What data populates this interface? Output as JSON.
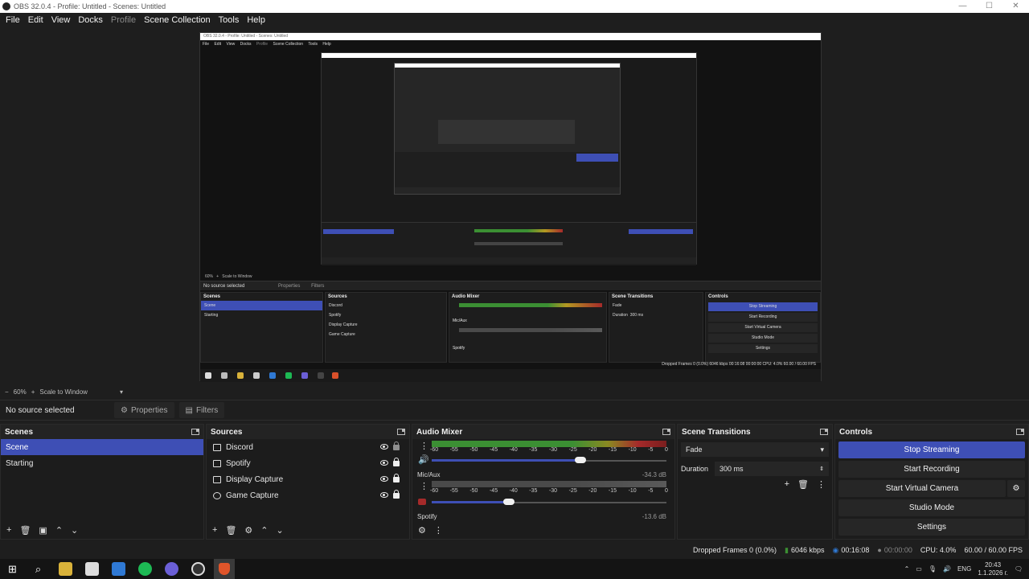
{
  "window": {
    "title": "OBS 32.0.4 - Profile: Untitled - Scenes: Untitled",
    "buttons": [
      "—",
      "☐",
      "✕"
    ]
  },
  "menu": [
    "File",
    "Edit",
    "View",
    "Docks",
    "Profile",
    "Scene Collection",
    "Tools",
    "Help"
  ],
  "nested": {
    "title": "OBS 32.0.4 - Profile: Untitled - Scenes: Untitled",
    "menu": [
      "File",
      "Edit",
      "View",
      "Docks",
      "Profile",
      "Scene Collection",
      "Tools",
      "Help"
    ],
    "status_zoom": "60%",
    "scale": "Scale to Window",
    "no_source": "No source selected",
    "properties": "Properties",
    "filters": "Filters",
    "scenes_head": "Scenes",
    "scenes": [
      "Scene",
      "Starting"
    ],
    "sources_head": "Sources",
    "sources": [
      "Discord",
      "Spotify",
      "Display Capture",
      "Game Capture"
    ],
    "mixer_head": "Audio Mixer",
    "mic": "Mic/Aux",
    "spotify": "Spotify",
    "transitions_head": "Scene Transitions",
    "fade": "Fade",
    "duration": "Duration",
    "duration_val": "300 ms",
    "controls_head": "Controls",
    "controls": [
      "Stop Streaming",
      "Start Recording",
      "Start Virtual Camera",
      "Studio Mode",
      "Settings"
    ],
    "statusbar": "Dropped Frames 0 (0.0%)   6046 kbps   00:16:08   00:00:00   CPU: 4.0%   60.00 / 60.00 FPS"
  },
  "zoom_row": {
    "zoom": "60%",
    "scale": "Scale to Window"
  },
  "props_bar": {
    "no_source": "No source selected",
    "properties": "Properties",
    "filters": "Filters"
  },
  "scenes": {
    "title": "Scenes",
    "items": [
      "Scene",
      "Starting"
    ],
    "selected": 0
  },
  "sources": {
    "title": "Sources",
    "items": [
      "Discord",
      "Spotify",
      "Display Capture",
      "Game Capture"
    ]
  },
  "mixer": {
    "title": "Audio Mixer",
    "ticks": [
      "-60",
      "-55",
      "-50",
      "-45",
      "-40",
      "-35",
      "-30",
      "-25",
      "-20",
      "-15",
      "-10",
      "-5",
      "0"
    ],
    "channels": [
      {
        "name": "",
        "db": "",
        "level": 0.62
      },
      {
        "name": "Mic/Aux",
        "db": "-34.3 dB",
        "level": 0.36
      },
      {
        "name": "Spotify",
        "db": "-13.6 dB",
        "level": 0.0
      }
    ]
  },
  "transitions": {
    "title": "Scene Transitions",
    "selected": "Fade",
    "duration_label": "Duration",
    "duration_value": "300 ms"
  },
  "controls": {
    "title": "Controls",
    "buttons": [
      "Stop Streaming",
      "Start Recording",
      "Start Virtual Camera",
      "Studio Mode",
      "Settings"
    ]
  },
  "status": {
    "dropped": "Dropped Frames 0 (0.0%)",
    "bitrate": "6046 kbps",
    "live_time": "00:16:08",
    "rec_time": "00:00:00",
    "cpu": "CPU: 4.0%",
    "fps": "60.00 / 60.00 FPS"
  },
  "taskbar": {
    "lang": "ENG",
    "time": "20:43",
    "date": "1.1.2026 г."
  },
  "colors": {
    "accent": "#3e4fb5",
    "meter_green": "#3b8f33",
    "meter_yellow": "#b39822",
    "meter_red": "#a52a2a"
  }
}
